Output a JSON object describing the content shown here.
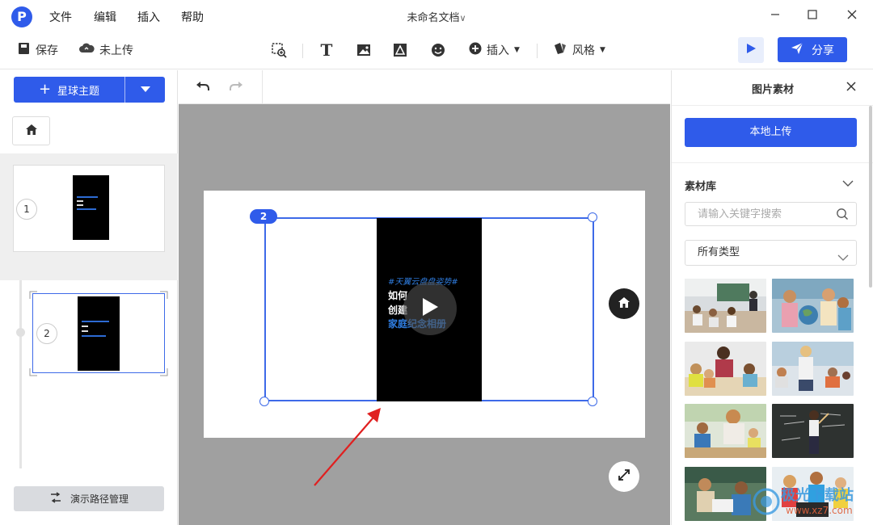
{
  "app": {
    "logo": "P",
    "menu": [
      "文件",
      "编辑",
      "插入",
      "帮助"
    ],
    "doc_title": "未命名文档",
    "window_controls": [
      "minimize-icon",
      "maximize-icon",
      "close-icon"
    ]
  },
  "toolbar": {
    "save_label": "保存",
    "upload_status": "未上传",
    "insert_label": "插入",
    "style_label": "风格",
    "share_label": "分享",
    "icons": [
      "zoom-frame-icon",
      "text-icon",
      "image-icon",
      "shape-icon",
      "emoji-icon",
      "plus-circle-icon",
      "style-icon",
      "play-icon"
    ]
  },
  "left_panel": {
    "theme_button": "星球主题",
    "slides": [
      {
        "number": "1"
      },
      {
        "number": "2"
      }
    ],
    "path_manager": "演示路径管理"
  },
  "canvas": {
    "frame_badge": "2",
    "video_lines": [
      "#天翼云盘盘姿势#",
      "如何",
      "创建",
      "家庭纪念相册"
    ]
  },
  "right_panel": {
    "title": "图片素材",
    "upload_button": "本地上传",
    "library_label": "素材库",
    "search_placeholder": "请输入关键字搜索",
    "type_select": "所有类型",
    "images": [
      "classroom-photo",
      "globe-lesson-photo",
      "teacher-kids-photo",
      "teacher-class-photo",
      "teacher-helping-photo",
      "chalkboard-photo",
      "kids-reading-photo",
      "kids-tablet-photo"
    ]
  },
  "watermark": {
    "text": "极光下载站",
    "url": "www.xz7.com"
  },
  "colors": {
    "accent": "#2f5bea",
    "frame": "#3d6ae8",
    "canvas_bg": "#a0a0a0",
    "arrow": "#e02020"
  }
}
